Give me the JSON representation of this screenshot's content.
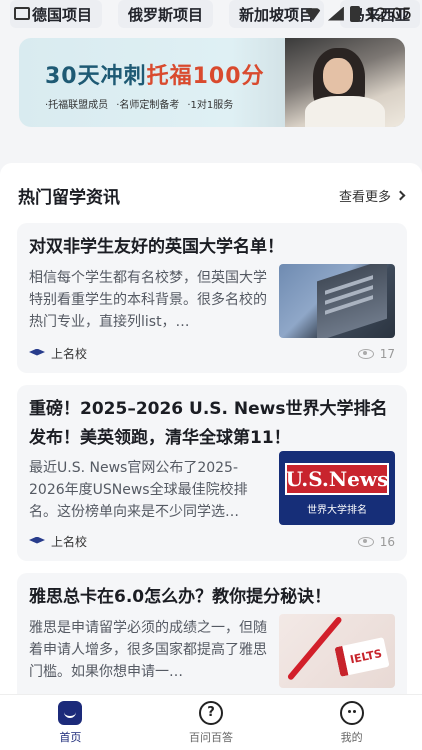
{
  "status": {
    "time": "12:05"
  },
  "projects": [
    "德国项目",
    "俄罗斯项目",
    "新加坡项目",
    "马来西亚"
  ],
  "banner": {
    "title_prefix": "30天冲刺",
    "title_highlight": "托福100分",
    "tags": [
      "·托福联盟成员",
      "·名师定制备考",
      "·1对1服务"
    ]
  },
  "news": {
    "title": "热门留学资讯",
    "more_label": "查看更多",
    "articles": [
      {
        "title": "对双非学生友好的英国大学名单！",
        "excerpt": "相信每个学生都有名校梦，但英国大学特别看重学生的本科背景。很多名校的热门专业，直接列list，…",
        "source": "上名校",
        "views": "17"
      },
      {
        "title": "重磅！2025–2026 U.S. News世界大学排名发布！美英领跑，清华全球第11！",
        "excerpt": "最近U.S. News官网公布了2025-2026年度USNews全球最佳院校排名。这份榜单向来是不少同学选…",
        "source": "上名校",
        "views": "16",
        "thumb_logo": "U.S.News",
        "thumb_caption": "世界大学排名"
      },
      {
        "title": "雅思总卡在6.0怎么办？教你提分秘诀！",
        "excerpt": "雅思是申请留学必须的成绩之一，但随着申请人增多，很多国家都提高了雅思门槛。如果你想申请一…",
        "thumb_logo": "IELTS"
      }
    ]
  },
  "tabs": [
    {
      "label": "首页",
      "active": true
    },
    {
      "label": "百问百答",
      "active": false
    },
    {
      "label": "我的",
      "active": false
    }
  ],
  "colors": {
    "brand": "#1c2a7a",
    "highlight": "#d94a2e"
  }
}
